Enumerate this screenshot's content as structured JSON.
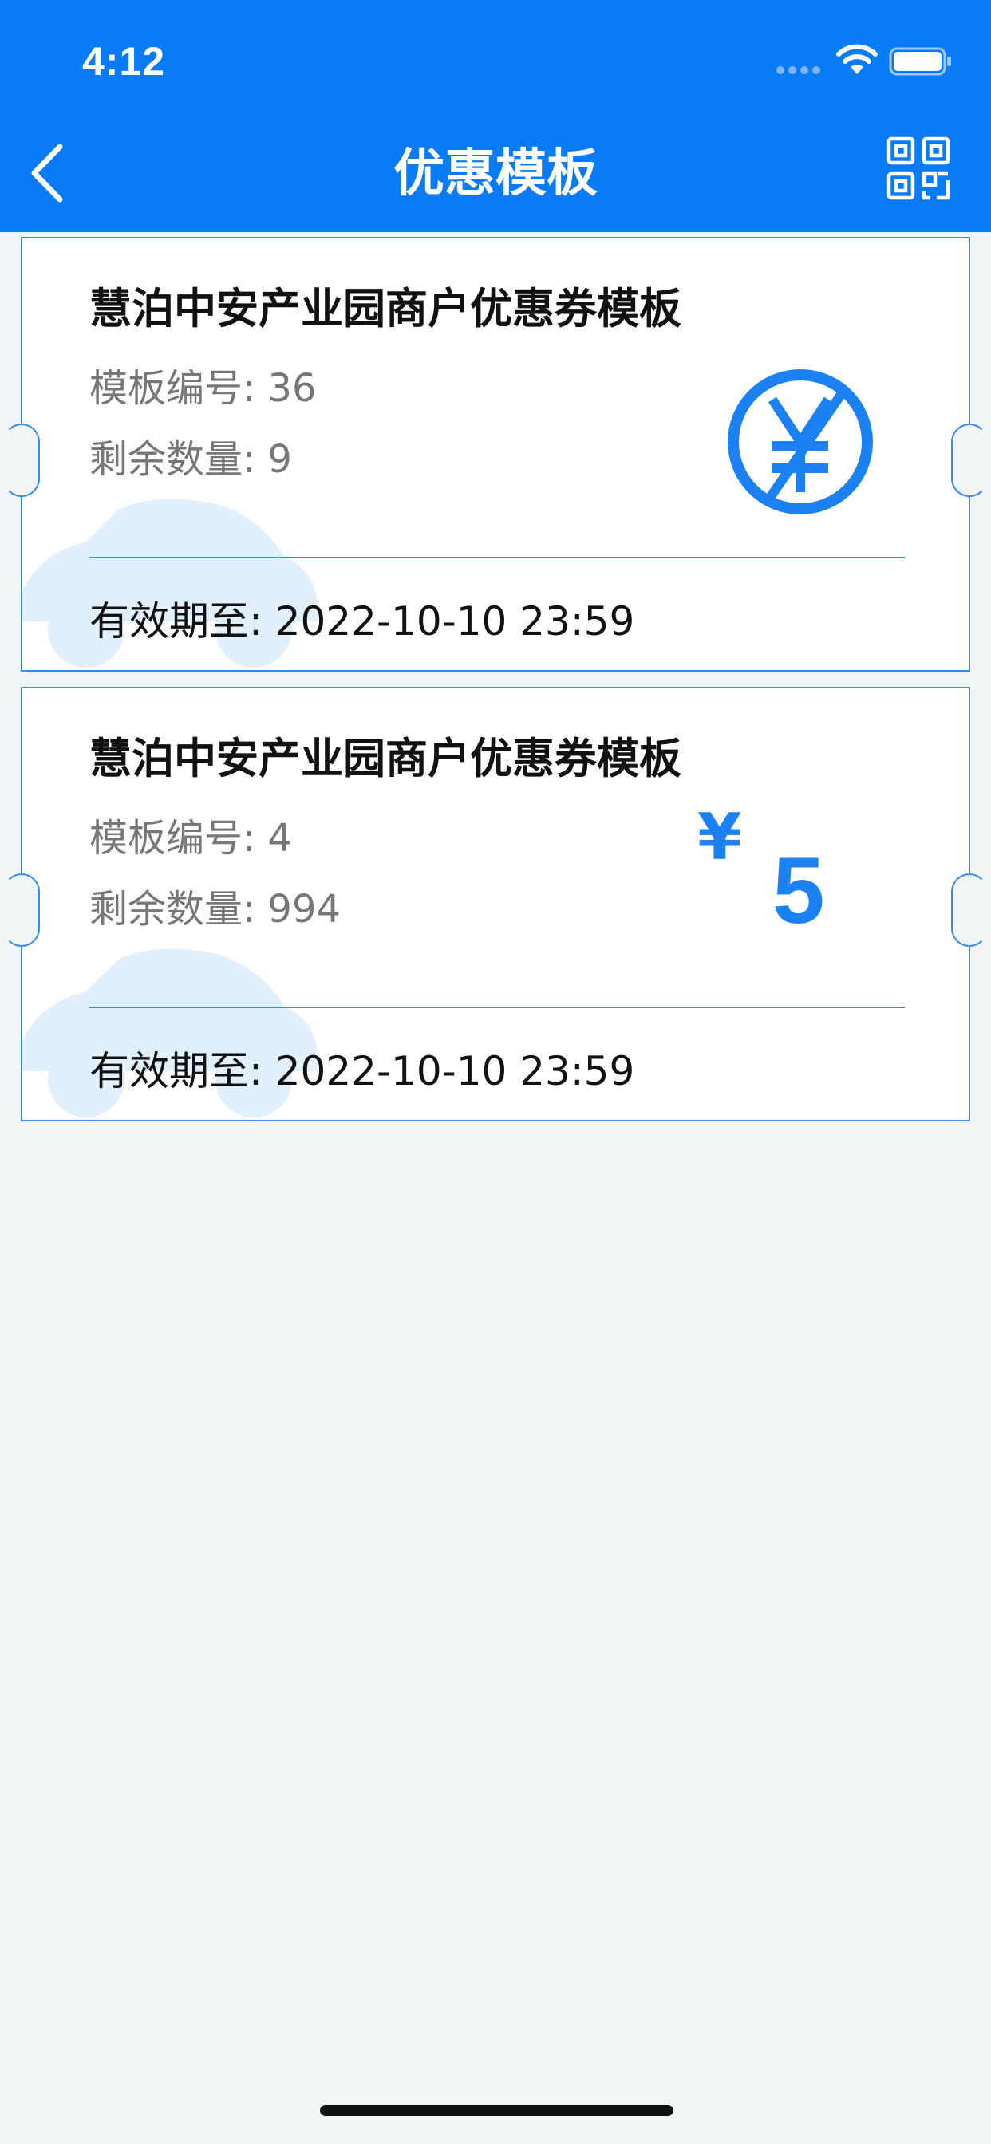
{
  "status_bar": {
    "time": "4:12"
  },
  "header": {
    "title": "优惠模板",
    "back_icon": "chevron-left-icon",
    "right_icon": "qr-code-icon"
  },
  "colors": {
    "brand": "#0a7bf6",
    "accent": "#1c82f3",
    "background": "#f1f5f6"
  },
  "coupons": [
    {
      "title": "慧泊中安产业园商户优惠券模板",
      "template_no": "模板编号: 36",
      "remaining": "剩余数量: 9",
      "expiry": "有效期至: 2022-10-10 23:59",
      "badge_icon": "no-yuan-icon"
    },
    {
      "title": "慧泊中安产业园商户优惠券模板",
      "template_no": "模板编号: 4",
      "remaining": "剩余数量: 994",
      "expiry": "有效期至: 2022-10-10 23:59",
      "currency": "¥",
      "amount": "5"
    }
  ]
}
